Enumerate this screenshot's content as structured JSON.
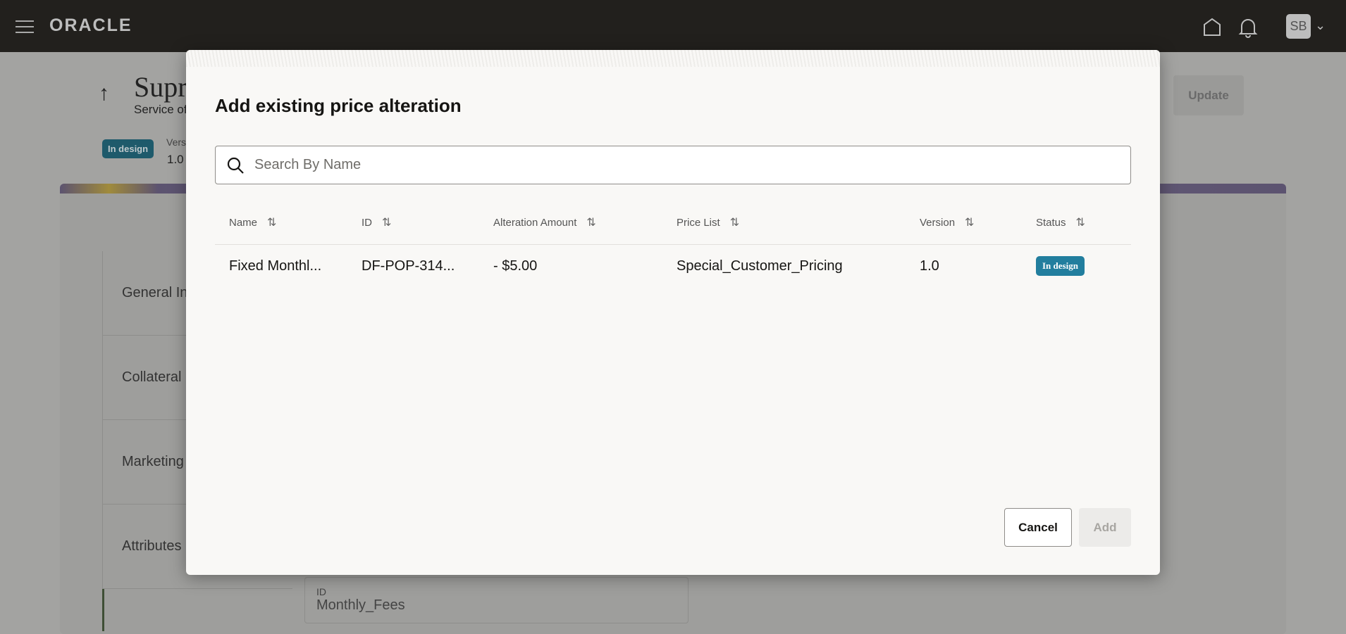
{
  "header": {
    "logo": "ORACLE",
    "avatar_initials": "SB"
  },
  "background": {
    "title": "Supr",
    "subtitle": "Service of",
    "status_badge": "In design",
    "version_label": "Vers",
    "version_value": "1.0",
    "update_button": "Update",
    "nav_items": [
      "General In",
      "Collateral",
      "Marketing",
      "Attributes"
    ],
    "id_field": {
      "label": "ID",
      "value": "Monthly_Fees"
    }
  },
  "dialog": {
    "title": "Add existing price alteration",
    "search": {
      "placeholder": "Search By Name",
      "value": ""
    },
    "columns": [
      "Name",
      "ID",
      "Alteration Amount",
      "Price List",
      "Version",
      "Status"
    ],
    "rows": [
      {
        "name": "Fixed Monthl...",
        "id": "DF-POP-314...",
        "amount": "- $5.00",
        "price_list": "Special_Customer_Pricing",
        "version": "1.0",
        "status": "In design"
      }
    ],
    "cancel_label": "Cancel",
    "add_label": "Add"
  },
  "colors": {
    "status_badge": "#227e9e",
    "header_bg": "#22201d"
  }
}
